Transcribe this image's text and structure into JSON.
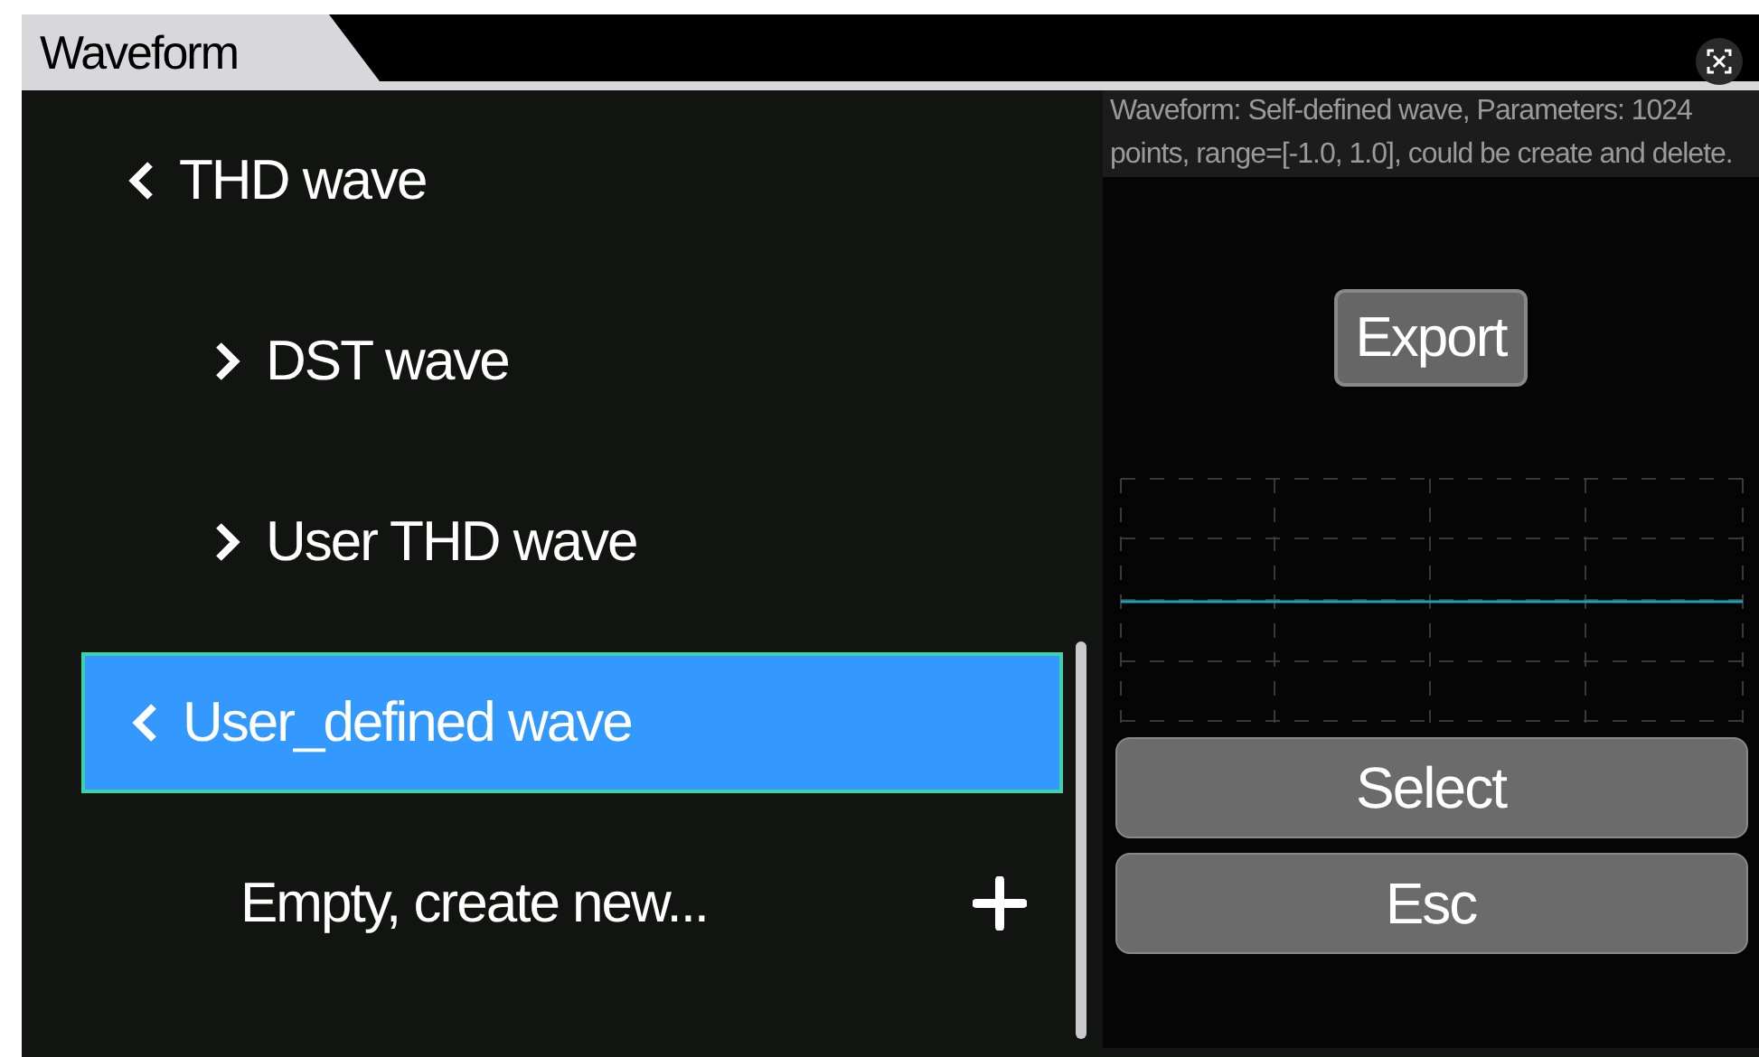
{
  "window": {
    "title": "Waveform"
  },
  "tree": [
    {
      "label": "THD wave",
      "expanded": true,
      "selected": false,
      "children": [
        {
          "label": "DST wave",
          "expanded": false,
          "selected": false
        },
        {
          "label": "User THD wave",
          "expanded": false,
          "selected": false
        }
      ]
    },
    {
      "label": "User_defined wave",
      "expanded": true,
      "selected": true,
      "children": [
        {
          "label": "Empty, create new...",
          "kind": "create",
          "selected": false
        }
      ]
    }
  ],
  "description": "Waveform: Self-defined wave, Parameters: 1024 points, range=[-1.0, 1.0], could be create and delete.",
  "export_button": "Export",
  "buttons": [
    "Select",
    "Esc"
  ]
}
